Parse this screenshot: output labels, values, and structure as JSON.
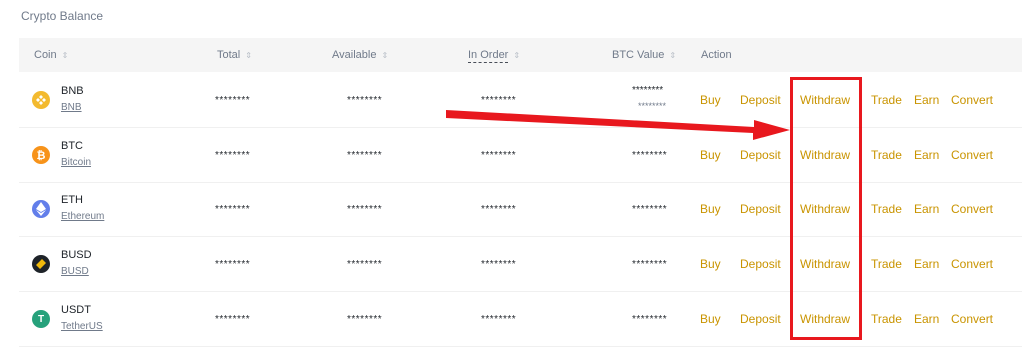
{
  "section": {
    "title": "Crypto Balance"
  },
  "table": {
    "columns": {
      "coin": "Coin",
      "total": "Total",
      "available": "Available",
      "in_order": "In Order",
      "btc_value": "BTC Value",
      "action": "Action"
    },
    "sort_icon": "⇕",
    "rows": [
      {
        "symbol": "BNB",
        "name": "BNB",
        "icon": "bnb-icon",
        "color": "#f3ba2f",
        "total": "********",
        "available": "********",
        "in_order": "********",
        "btc_value": "********",
        "btc_sub": "********"
      },
      {
        "symbol": "BTC",
        "name": "Bitcoin",
        "icon": "btc-icon",
        "color": "#f7931a",
        "total": "********",
        "available": "********",
        "in_order": "********",
        "btc_value": "********"
      },
      {
        "symbol": "ETH",
        "name": "Ethereum",
        "icon": "eth-icon",
        "color": "#627eea",
        "total": "********",
        "available": "********",
        "in_order": "********",
        "btc_value": "********"
      },
      {
        "symbol": "BUSD",
        "name": "BUSD",
        "icon": "busd-icon",
        "color": "#1e2329",
        "total": "********",
        "available": "********",
        "in_order": "********",
        "btc_value": "********"
      },
      {
        "symbol": "USDT",
        "name": "TetherUS",
        "icon": "usdt-icon",
        "color": "#26a17b",
        "total": "********",
        "available": "********",
        "in_order": "********",
        "btc_value": "********"
      }
    ],
    "actions": {
      "buy": "Buy",
      "deposit": "Deposit",
      "withdraw": "Withdraw",
      "trade": "Trade",
      "earn": "Earn",
      "convert": "Convert"
    }
  },
  "annotation": {
    "highlight_color": "#e8181e",
    "arrow_color": "#e8181e"
  }
}
